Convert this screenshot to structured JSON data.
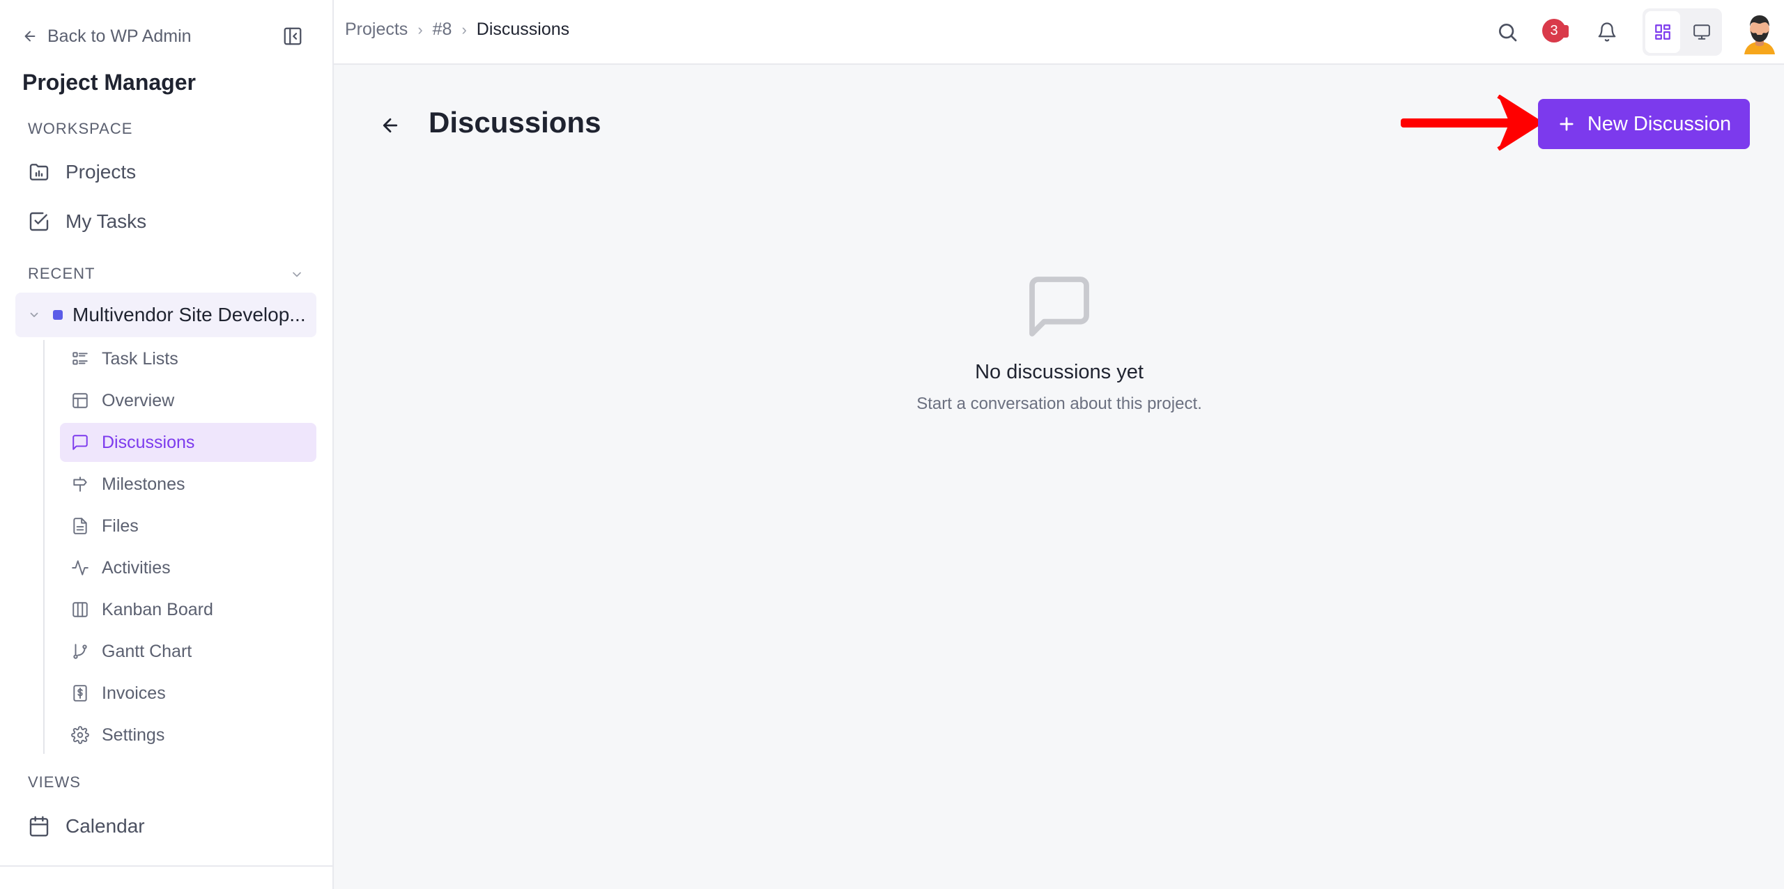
{
  "sidebar": {
    "back_label": "Back to WP Admin",
    "app_title": "Project Manager",
    "workspace_label": "WORKSPACE",
    "workspace_items": [
      {
        "label": "Projects",
        "icon": "folder-chart-icon"
      },
      {
        "label": "My Tasks",
        "icon": "checkbox-icon"
      }
    ],
    "recent_label": "RECENT",
    "project": {
      "name": "Multivendor Site Develop...",
      "color": "#5b5ce8"
    },
    "project_items": [
      {
        "label": "Task Lists",
        "icon": "list-icon",
        "active": false
      },
      {
        "label": "Overview",
        "icon": "layout-icon",
        "active": false
      },
      {
        "label": "Discussions",
        "icon": "message-icon",
        "active": true
      },
      {
        "label": "Milestones",
        "icon": "signpost-icon",
        "active": false
      },
      {
        "label": "Files",
        "icon": "file-icon",
        "active": false
      },
      {
        "label": "Activities",
        "icon": "activity-icon",
        "active": false
      },
      {
        "label": "Kanban Board",
        "icon": "columns-icon",
        "active": false
      },
      {
        "label": "Gantt Chart",
        "icon": "git-branch-icon",
        "active": false
      },
      {
        "label": "Invoices",
        "icon": "dollar-doc-icon",
        "active": false
      },
      {
        "label": "Settings",
        "icon": "gear-icon",
        "active": false
      }
    ],
    "views_label": "VIEWS",
    "views_items": [
      {
        "label": "Calendar",
        "icon": "calendar-icon"
      }
    ]
  },
  "topbar": {
    "breadcrumb": [
      "Projects",
      "#8",
      "Discussions"
    ],
    "notification_count": "3"
  },
  "main": {
    "title": "Discussions",
    "new_button_label": "New Discussion",
    "empty_title": "No discussions yet",
    "empty_subtitle": "Start a conversation about this project."
  },
  "colors": {
    "accent": "#7c3aed",
    "active_bg": "#efe6fc",
    "badge": "#d93a4a",
    "annotation_arrow": "#ff0000"
  }
}
